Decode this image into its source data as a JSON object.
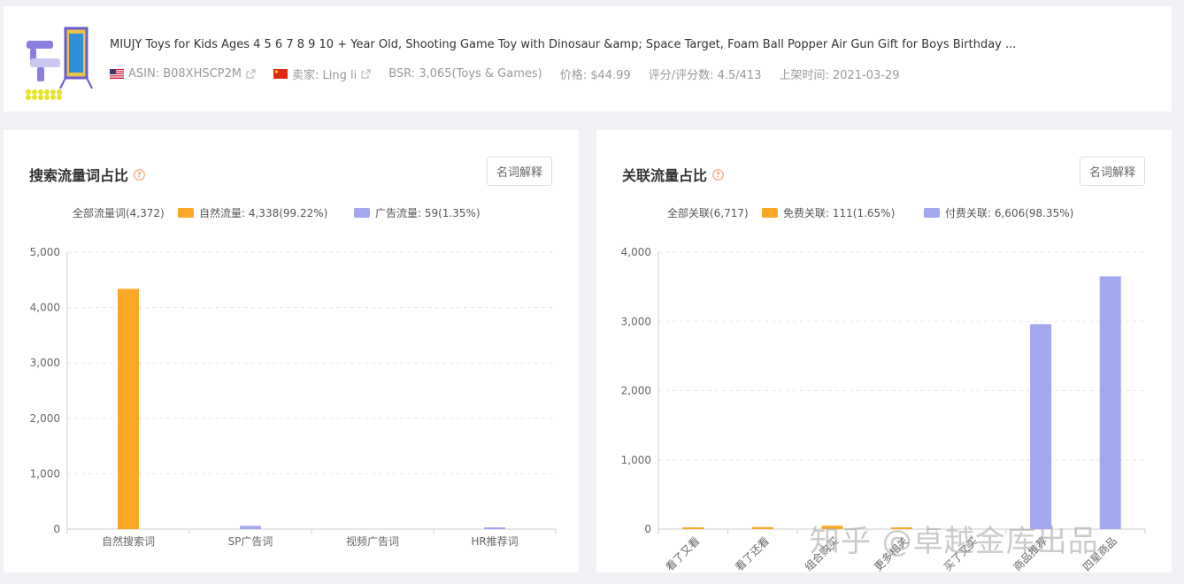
{
  "product": {
    "title": "MIUJY Toys for Kids Ages 4 5 6 7 8 9 10 + Year Old, Shooting Game Toy with Dinosaur &amp; Space Target, Foam Ball Popper Air Gun Gift for Boys Birthday ...",
    "asin": "ASIN: B08XHSCP2M",
    "seller": "卖家: Ling li",
    "bsr": "BSR: 3,065(Toys & Games)",
    "price": "价格: $44.99",
    "rating": "评分/评分数: 4.5/413",
    "launch": "上架时间: 2021-03-29"
  },
  "left_panel": {
    "title": "搜索流量词占比",
    "explain_label": "名词解释",
    "legend_total": "全部流量词(4,372)",
    "legend_natural": "自然流量: 4,338(99.22%)",
    "legend_ad": "广告流量: 59(1.35%)"
  },
  "right_panel": {
    "title": "关联流量占比",
    "explain_label": "名词解释",
    "legend_total": "全部关联(6,717)",
    "legend_free": "免费关联: 111(1.65%)",
    "legend_paid": "付费关联: 6,606(98.35%)"
  },
  "colors": {
    "natural": "#f9a825",
    "ad": "#a2a7ef",
    "free": "#f9a825",
    "paid": "#a2a7ef",
    "help": "#f0a070"
  },
  "chart_data": [
    {
      "type": "bar",
      "categories": [
        "自然搜索词",
        "SP广告词",
        "视频广告词",
        "HR推荐词"
      ],
      "series": [
        {
          "name": "自然流量",
          "values": [
            4338,
            0,
            0,
            0
          ]
        },
        {
          "name": "广告流量",
          "values": [
            0,
            59,
            0,
            3
          ]
        }
      ],
      "yticks": [
        "0",
        "1,000",
        "2,000",
        "3,000",
        "4,000",
        "5,000"
      ],
      "ylim": [
        0,
        5000
      ],
      "grid": true,
      "legend": "top-left"
    },
    {
      "type": "bar",
      "categories": [
        "看了又看",
        "看了还看",
        "组合购买",
        "更多相关",
        "买了又买",
        "商品推荐",
        "四星商品"
      ],
      "series": [
        {
          "name": "免费关联",
          "values": [
            10,
            30,
            50,
            20,
            0,
            0,
            0
          ]
        },
        {
          "name": "付费关联",
          "values": [
            0,
            0,
            0,
            0,
            0,
            2960,
            3650
          ]
        }
      ],
      "yticks": [
        "0",
        "1,000",
        "2,000",
        "3,000",
        "4,000"
      ],
      "ylim": [
        0,
        4000
      ],
      "grid": true,
      "legend": "top-left"
    }
  ],
  "watermark": "知乎 @卓越金库出品"
}
